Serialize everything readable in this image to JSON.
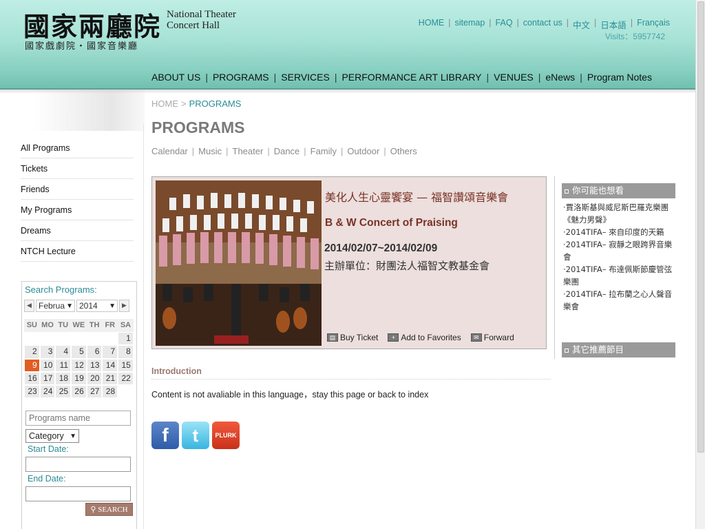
{
  "header": {
    "logo_cn": "國家兩廳院",
    "logo_en_line1": "National Theater",
    "logo_en_line2": "Concert Hall",
    "logo_subtitle": "國家戲劇院・國家音樂廳",
    "top_links": [
      "HOME",
      "sitemap",
      "FAQ",
      "contact us",
      "中文",
      "日本語",
      "Français"
    ],
    "visits": "Visits：5957742",
    "main_nav": [
      "ABOUT US",
      "PROGRAMS",
      "SERVICES",
      "PERFORMANCE ART LIBRARY",
      "VENUES",
      "eNews",
      "Program Notes"
    ]
  },
  "sidebar": {
    "items": [
      "All Programs",
      "Tickets",
      "Friends",
      "My Programs",
      "Dreams",
      "NTCH Lecture"
    ]
  },
  "search": {
    "title": "Search Programs:",
    "month_value": "Februa",
    "year_value": "2014",
    "weekdays": [
      "SU",
      "MO",
      "TU",
      "WE",
      "TH",
      "FR",
      "SA"
    ],
    "days": [
      "",
      "",
      "",
      "",
      "",
      "",
      "1",
      "2",
      "3",
      "4",
      "5",
      "6",
      "7",
      "8",
      "9",
      "10",
      "11",
      "12",
      "13",
      "14",
      "15",
      "16",
      "17",
      "18",
      "19",
      "20",
      "21",
      "22",
      "23",
      "24",
      "25",
      "26",
      "27",
      "28",
      ""
    ],
    "today": "9",
    "program_name_placeholder": "Programs name",
    "category_value": "Category",
    "start_date_label": "Start Date:",
    "end_date_label": "End Date:",
    "button_label": "SEARCH"
  },
  "breadcrumb": {
    "home": "HOME",
    "sep": ">",
    "current": "PROGRAMS"
  },
  "page_title": "PROGRAMS",
  "sub_nav": [
    "Calendar",
    "Music",
    "Theater",
    "Dance",
    "Family",
    "Outdoor",
    "Others"
  ],
  "program": {
    "title_cn": "美化人生心靈饗宴 — 福智讚頌音樂會",
    "title_en": "B & W Concert of Praising",
    "date": "2014/02/07~2014/02/09",
    "organizer": "主辦單位：財團法人福智文教基金會",
    "actions": [
      "Buy Ticket",
      "Add to Favorites",
      "Forward"
    ]
  },
  "introduction": {
    "title": "Introduction",
    "text": "Content is not avaliable in this language，stay this page or back to index"
  },
  "social": {
    "facebook": "f",
    "twitter": "t",
    "plurk": "PLURK"
  },
  "recommend": {
    "heading1": "你可能也想看",
    "items": [
      "‧賈洛斯基與威尼斯巴羅克樂團《魅力男聲》",
      "‧2014TIFA– 來自印度的天籟",
      "‧2014TIFA– 寂靜之眼跨界音樂會",
      "‧2014TIFA– 布達佩斯節慶管弦樂團",
      "‧2014TIFA– 拉布蘭之心人聲音樂會"
    ],
    "heading2": "其它推薦節目"
  },
  "colors": {
    "accent": "#2a8c96",
    "header": "#86cfc0",
    "card": "#ecdfdd",
    "today": "#e15d22",
    "title_red": "#7a3226"
  }
}
